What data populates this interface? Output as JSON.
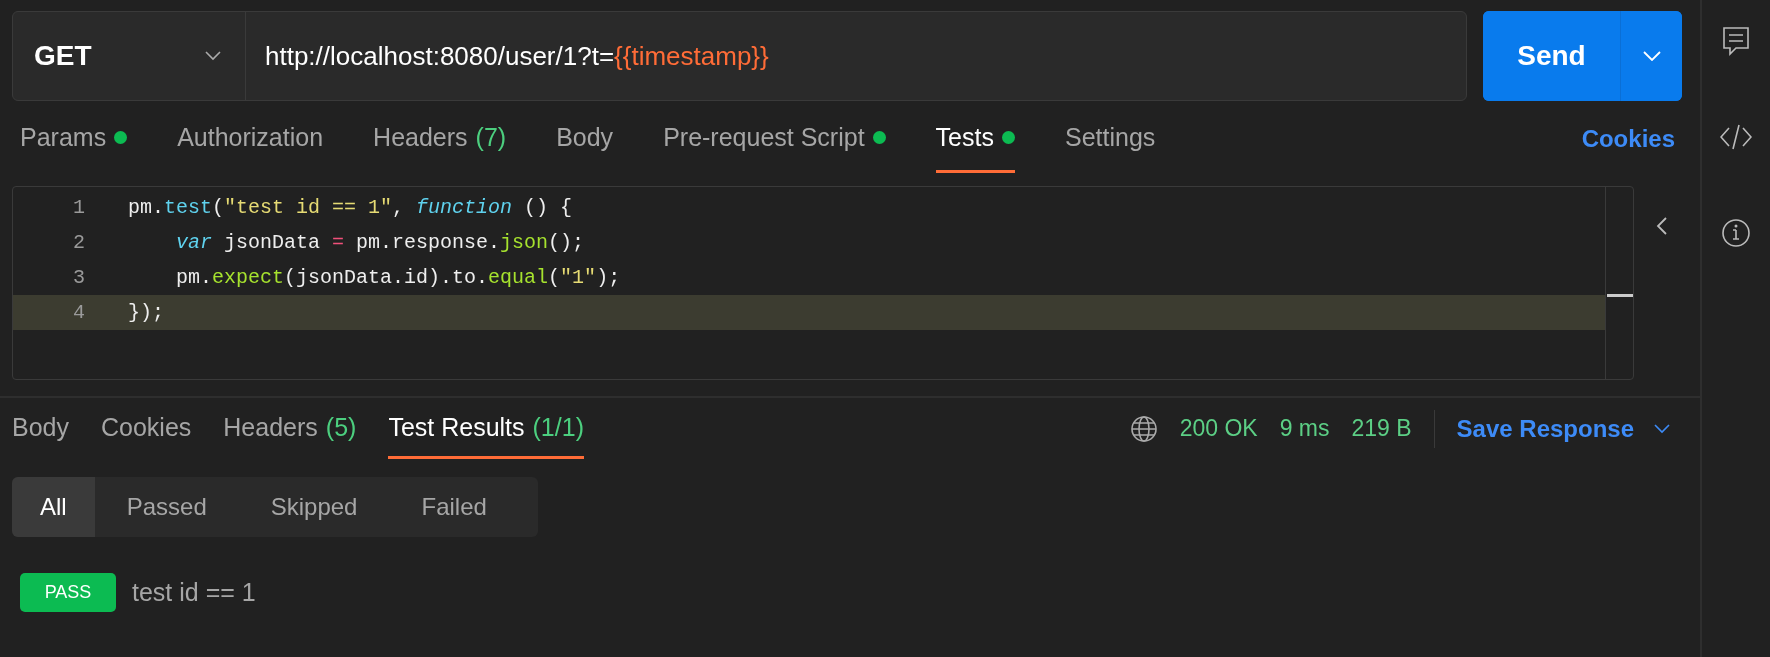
{
  "request": {
    "method": "GET",
    "url": [
      {
        "t": "http://localhost:8080/user/1?t=",
        "kind": "text"
      },
      {
        "t": "{{timestamp}}",
        "kind": "variable"
      }
    ],
    "send": "Send"
  },
  "request_tabs": [
    {
      "label": "Params",
      "dot": true,
      "selected": false
    },
    {
      "label": "Authorization",
      "dot": false,
      "selected": false
    },
    {
      "label": "Headers",
      "count": "(7)",
      "dot": false,
      "selected": false
    },
    {
      "label": "Body",
      "dot": false,
      "selected": false
    },
    {
      "label": "Pre-request Script",
      "dot": true,
      "selected": false
    },
    {
      "label": "Tests",
      "dot": true,
      "selected": true
    },
    {
      "label": "Settings",
      "dot": false,
      "selected": false
    }
  ],
  "cookies_link": "Cookies",
  "editor": {
    "lines": [
      {
        "number": "1",
        "active": false,
        "indent": false,
        "tokens": [
          {
            "t": "pm.",
            "kind": "plain"
          },
          {
            "t": "test",
            "kind": "method"
          },
          {
            "t": "(",
            "kind": "plain"
          },
          {
            "t": "\"test id == 1\"",
            "kind": "str"
          },
          {
            "t": ", ",
            "kind": "plain"
          },
          {
            "t": "function",
            "kind": "kw"
          },
          {
            "t": " () {",
            "kind": "plain"
          }
        ]
      },
      {
        "number": "2",
        "active": false,
        "indent": true,
        "tokens": [
          {
            "t": "var",
            "kind": "kw"
          },
          {
            "t": " jsonData ",
            "kind": "plain"
          },
          {
            "t": "=",
            "kind": "op"
          },
          {
            "t": " pm.response.",
            "kind": "plain"
          },
          {
            "t": "json",
            "kind": "call"
          },
          {
            "t": "();",
            "kind": "plain"
          }
        ]
      },
      {
        "number": "3",
        "active": false,
        "indent": true,
        "tokens": [
          {
            "t": "pm.",
            "kind": "plain"
          },
          {
            "t": "expect",
            "kind": "call"
          },
          {
            "t": "(jsonData.id).to.",
            "kind": "plain"
          },
          {
            "t": "equal",
            "kind": "call"
          },
          {
            "t": "(",
            "kind": "plain"
          },
          {
            "t": "\"1\"",
            "kind": "str"
          },
          {
            "t": ");",
            "kind": "plain"
          }
        ]
      },
      {
        "number": "4",
        "active": true,
        "indent": false,
        "tokens": [
          {
            "t": "});",
            "kind": "plain"
          }
        ]
      }
    ]
  },
  "response": {
    "tabs": [
      {
        "label": "Body",
        "selected": false
      },
      {
        "label": "Cookies",
        "selected": false
      },
      {
        "label": "Headers",
        "count": "(5)",
        "selected": false
      },
      {
        "label": "Test Results",
        "count": "(1/1)",
        "selected": true
      }
    ],
    "status": "200 OK",
    "time": "9 ms",
    "size": "219 B",
    "save": "Save Response",
    "filters": [
      {
        "label": "All",
        "selected": true
      },
      {
        "label": "Passed",
        "selected": false
      },
      {
        "label": "Skipped",
        "selected": false
      },
      {
        "label": "Failed",
        "selected": false
      }
    ],
    "results": [
      {
        "kind": "pass",
        "badge": "PASS",
        "name": "test id == 1"
      }
    ]
  }
}
